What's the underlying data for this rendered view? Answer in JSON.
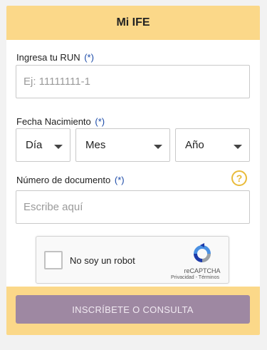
{
  "header": {
    "title": "Mi IFE"
  },
  "run": {
    "label": "Ingresa tu RUN",
    "required_mark": "(*)",
    "placeholder": "Ej: 11111111-1"
  },
  "birth": {
    "label": "Fecha Nacimiento",
    "required_mark": "(*)",
    "day": "Día",
    "month": "Mes",
    "year": "Año"
  },
  "document": {
    "label": "Número de documento",
    "required_mark": "(*)",
    "placeholder": "Escribe aquí",
    "help_glyph": "?"
  },
  "recaptcha": {
    "label": "No soy un robot",
    "brand": "reCAPTCHA",
    "links": "Privacidad - Términos"
  },
  "submit": {
    "label": "INSCRÍBETE O CONSULTA"
  },
  "colors": {
    "accent": "#fbd889",
    "button": "#9e88a2",
    "required": "#1b4aa8",
    "help": "#e9bb3a"
  }
}
